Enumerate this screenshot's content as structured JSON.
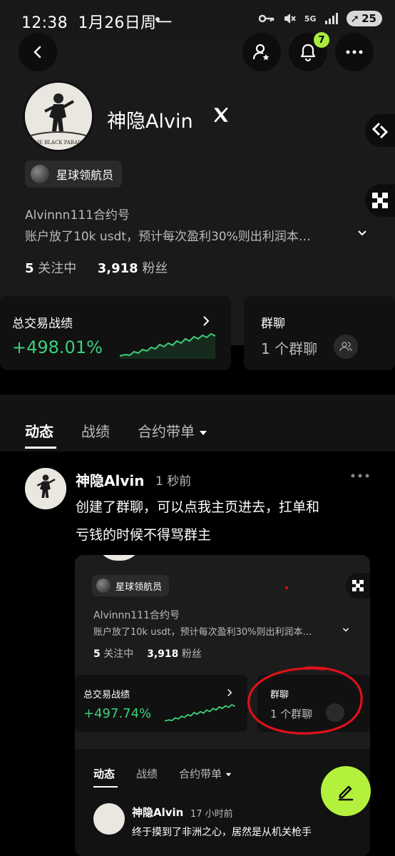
{
  "status_bar": {
    "time": "12:38",
    "date": "1月26日周一",
    "signal_label": "5G",
    "battery": "25"
  },
  "top_bar": {
    "notification_count": "7"
  },
  "profile": {
    "name": "神隐Alvin",
    "title_badge": "星球领航员",
    "handle": "Alvinnn111合约号",
    "bio": "账户放了10k usdt，预计每次盈利30%则出利润本…",
    "following_count": "5",
    "following_label": "关注中",
    "followers_count": "3,918",
    "followers_label": "粉丝"
  },
  "stats_card": {
    "title": "总交易战绩",
    "value": "+498.01%"
  },
  "group_card": {
    "title": "群聊",
    "value": "1 个群聊"
  },
  "tabs": [
    {
      "label": "动态",
      "active": true
    },
    {
      "label": "战绩",
      "active": false
    },
    {
      "label": "合约带单",
      "active": false
    }
  ],
  "post": {
    "author": "神隐Alvin",
    "time": "1 秒前",
    "text_line1": "创建了群聊，可以点我主页进去，扛单和",
    "text_line2": "亏钱的时候不得骂群主"
  },
  "embedded": {
    "title_badge": "星球领航员",
    "handle": "Alvinnn111合约号",
    "bio": "账户放了10k usdt，预计每次盈利30%则出利润本…",
    "following_count": "5",
    "following_label": "关注中",
    "followers_count": "3,918",
    "followers_label": "粉丝",
    "stats_title": "总交易战绩",
    "stats_value": "+497.74%",
    "group_title": "群聊",
    "group_value": "1 个群聊",
    "tabs": [
      "动态",
      "战绩",
      "合约带单"
    ],
    "post_author": "神隐Alvin",
    "post_time": "17 小时前",
    "post_text": "终于摸到了非洲之心，居然是从机关枪手"
  },
  "avatar_text": [
    "THE BLACK PARADE"
  ],
  "colors": {
    "accent": "#b4f13c",
    "positive": "#3dd07a",
    "badge": "#a8ec3e",
    "annotation": "#e0101a"
  },
  "icons": [
    "back-icon",
    "add-friend-icon",
    "bell-icon",
    "more-icon",
    "x-logo-icon",
    "share-icon",
    "qr-icon",
    "chevron-right-icon",
    "chevron-down-icon",
    "group-icon",
    "edit-icon"
  ]
}
